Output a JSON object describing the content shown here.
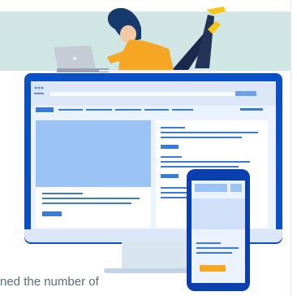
{
  "caption": "ned the number of",
  "colors": {
    "monitor": "#0a4fc4",
    "screen_bg": "#eaf2fd",
    "accent": "#3a7bd5",
    "button": "#f5a623",
    "teal": "#cfe6e4"
  },
  "icons": [
    "woman-illustration",
    "laptop-icon",
    "monitor-icon",
    "phone-icon"
  ]
}
